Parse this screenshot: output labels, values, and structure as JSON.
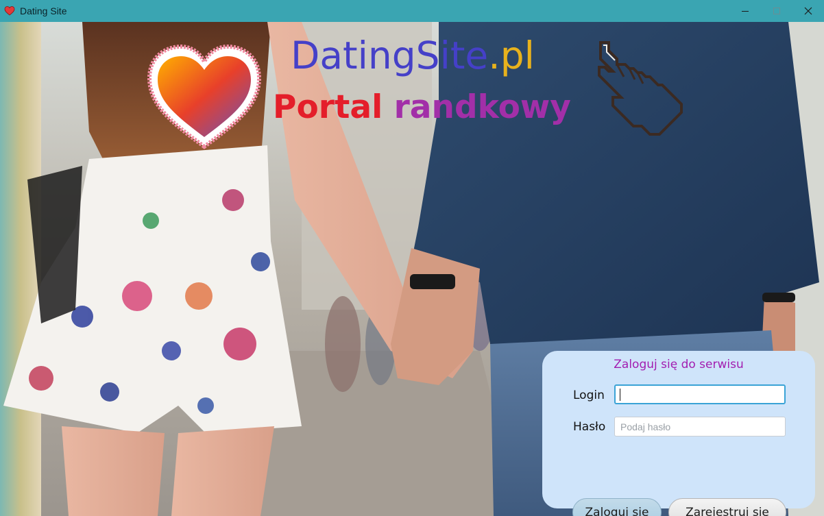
{
  "window": {
    "title": "Dating Site",
    "icons": {
      "app": "heart-icon",
      "minimize": "minimize-icon",
      "maximize": "maximize-icon",
      "close": "close-icon"
    }
  },
  "branding": {
    "site_name": "DatingSite",
    "site_tld": ".pl",
    "tagline_word1": "Portal",
    "tagline_word2": "randkowy",
    "colors": {
      "site_name": "#4540c8",
      "tld": "#e8b21d",
      "tagline_word1": "#e41e2a",
      "tagline_word2": "#a22fa8"
    }
  },
  "login_panel": {
    "title": "Zaloguj się do serwisu",
    "login_label": "Login",
    "login_value": "",
    "password_label": "Hasło",
    "password_placeholder": "Podaj hasło",
    "login_button": "Zaloguj się",
    "register_button": "Zarejestruj się",
    "colors": {
      "panel_bg": "#cfe4fa",
      "title": "#a21db0",
      "focus_border": "#3aa3d6"
    }
  }
}
